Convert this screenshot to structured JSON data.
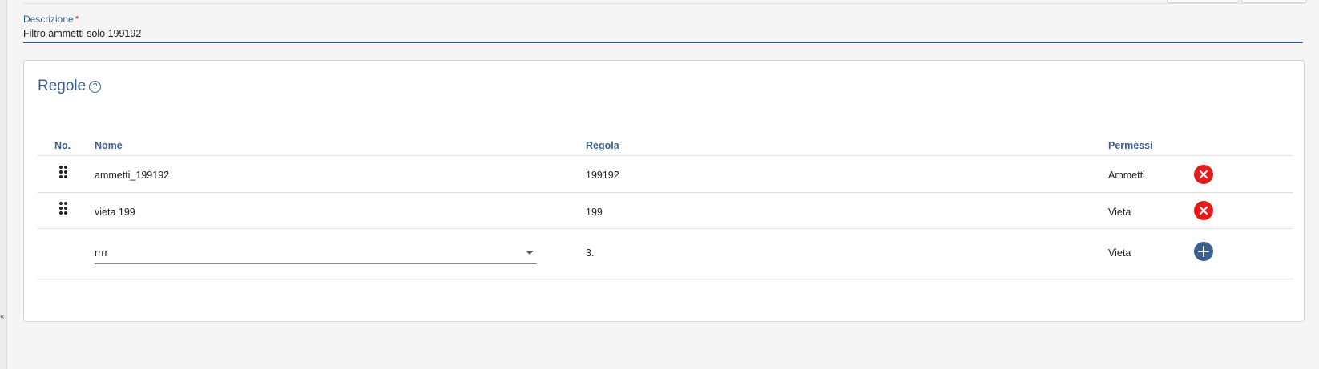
{
  "description_field": {
    "label": "Descrizione",
    "required_mark": "*",
    "value": "Filtro ammetti solo 199192"
  },
  "rules": {
    "title": "Regole",
    "help_glyph": "?",
    "columns": {
      "no": "No.",
      "nome": "Nome",
      "regola": "Regola",
      "permessi": "Permessi"
    },
    "rows": [
      {
        "nome": "ammetti_199192",
        "regola": "199192",
        "permessi": "Ammetti"
      },
      {
        "nome": "vieta 199",
        "regola": "199",
        "permessi": "Vieta"
      }
    ],
    "new_row": {
      "nome_selected": "rrrr",
      "regola": "3.",
      "permessi": "Vieta"
    }
  },
  "rail_toggle": "«",
  "colors": {
    "accent": "#3b5f8f",
    "delete": "#e31b1b",
    "required": "#d32f2f"
  }
}
